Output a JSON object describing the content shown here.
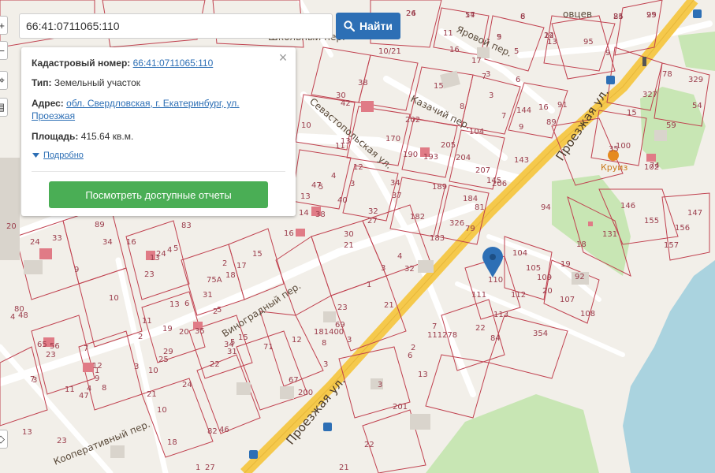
{
  "search": {
    "value": "66:41:0711065:110",
    "button_label": "Найти",
    "button_icon": "search-icon"
  },
  "popup": {
    "cadastral_label": "Кадастровый номер:",
    "cadastral_value": "66:41:0711065:110",
    "type_label": "Тип:",
    "type_value": "Земельный участок",
    "address_label": "Адрес:",
    "address_value": "обл. Свердловская, г. Екатеринбург, ул. Проезжая",
    "area_label": "Площадь:",
    "area_value": "415.64 кв.м.",
    "details_link": "Подробно",
    "reports_button": "Посмотреть доступные отчеты",
    "close_icon": "close-icon"
  },
  "map": {
    "colors": {
      "background": "#f2efe9",
      "plot_border": "#c0414f",
      "road": "#ffffff",
      "main_road": "#f5c94c",
      "water": "#aad3df",
      "park": "#c8e6b4",
      "marker": "#2d6fb5"
    },
    "streets": [
      {
        "id": "proezzhaya-upper",
        "label": "Проезжая ул."
      },
      {
        "id": "proezzhaya-lower",
        "label": "Проезжая ул."
      },
      {
        "id": "sevastopolskaya",
        "label": "Севастопольская ул."
      },
      {
        "id": "kazachiy",
        "label": "Казачий пер."
      },
      {
        "id": "yarovoy",
        "label": "Яровой пер."
      },
      {
        "id": "vinogradny",
        "label": "Виноградный пер."
      },
      {
        "id": "shkolny",
        "label": "Школьный пер."
      },
      {
        "id": "kooperativny",
        "label": "Кооперативный пер."
      },
      {
        "id": "udartsev",
        "label": "овцев"
      }
    ],
    "poi": {
      "name": "Круиз",
      "number": "35"
    },
    "plot_numbers": [
      "26",
      "14",
      "24",
      "99",
      "6",
      "5",
      "13",
      "14",
      "95",
      "9",
      "11",
      "16",
      "17",
      "5",
      "10/21",
      "38",
      "15",
      "7",
      "3",
      "8",
      "6",
      "30",
      "42",
      "202",
      "3",
      "16",
      "91",
      "89",
      "7",
      "9",
      "10",
      "11",
      "13",
      "170",
      "190",
      "193",
      "205",
      "204",
      "207",
      "206",
      "12",
      "4",
      "3",
      "47",
      "5",
      "40",
      "13",
      "14",
      "38",
      "34",
      "37",
      "32",
      "27",
      "182",
      "183",
      "326",
      "79",
      "189",
      "184",
      "81",
      "94",
      "131",
      "146",
      "155",
      "147",
      "156",
      "157",
      "18",
      "104",
      "105",
      "109",
      "20",
      "107",
      "108",
      "92",
      "19",
      "112",
      "111",
      "113",
      "22",
      "84",
      "354",
      "111278",
      "7",
      "10",
      "89",
      "20",
      "24",
      "33",
      "34",
      "16",
      "13",
      "4",
      "5",
      "23",
      "24",
      "18",
      "17",
      "15",
      "2",
      "16",
      "30",
      "21",
      "1",
      "3",
      "4",
      "32",
      "75А",
      "9",
      "23",
      "21",
      "3",
      "181400",
      "71",
      "69",
      "13",
      "6",
      "8",
      "2",
      "11",
      "1",
      "7",
      "12",
      "3",
      "31",
      "67",
      "34",
      "31",
      "5",
      "2",
      "20",
      "35",
      "5",
      "15",
      "19",
      "29",
      "22",
      "4",
      "48",
      "10",
      "25",
      "3",
      "47",
      "11",
      "23",
      "8",
      "4",
      "21",
      "12",
      "9",
      "13",
      "7",
      "24",
      "10",
      "2",
      "13",
      "200",
      "201",
      "3",
      "6",
      "65",
      "56",
      "80",
      "3",
      "82",
      "46",
      "23",
      "18",
      "1",
      "27",
      "22",
      "21",
      "59",
      "15",
      "327",
      "54",
      "329",
      "78",
      "74",
      "145",
      "100",
      "102",
      "143",
      "144",
      "104",
      "83",
      "24",
      "57",
      "85",
      "25",
      "8",
      "9",
      "1",
      "22"
    ],
    "marker_label": "110"
  }
}
